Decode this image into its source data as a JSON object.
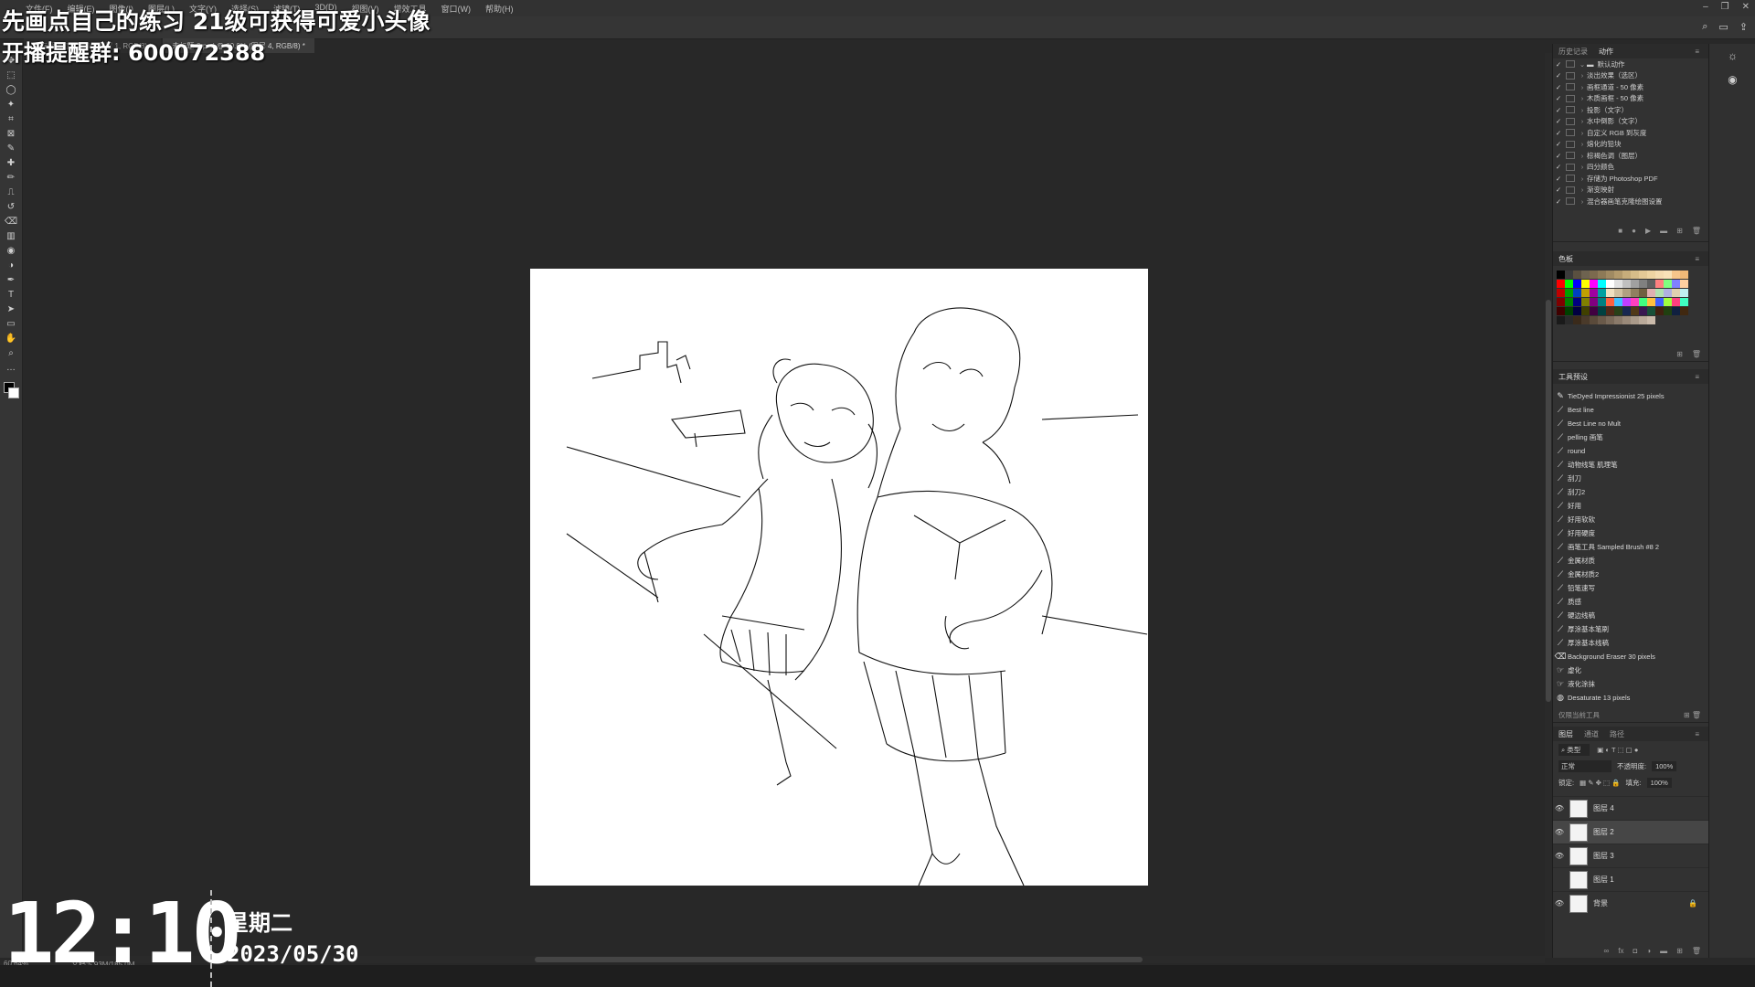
{
  "app": {
    "menu": [
      "文件(F)",
      "编辑(E)",
      "图像(I)",
      "图层(L)",
      "文字(Y)",
      "选择(S)",
      "滤镜(T)",
      "3D(D)",
      "视图(V)",
      "增效工具",
      "窗口(W)",
      "帮助(H)"
    ],
    "window_controls": [
      "–",
      "❐",
      "✕"
    ]
  },
  "doc_tabs": [
    {
      "label": "未标题-1 @ 66.7% (图层 1, RGB/8) *",
      "active": false
    },
    {
      "label": "未标题-2.psd @ 60.6% (图层 4, RGB/8) *",
      "active": true
    }
  ],
  "tools": [
    "move-tool",
    "marquee-tool",
    "lasso-tool",
    "quick-select-tool",
    "crop-tool",
    "frame-tool",
    "eyedropper-tool",
    "healing-tool",
    "brush-tool",
    "stamp-tool",
    "history-brush-tool",
    "eraser-tool",
    "gradient-tool",
    "blur-tool",
    "dodge-tool",
    "pen-tool",
    "type-tool",
    "path-select-tool",
    "shape-tool",
    "hand-tool",
    "zoom-tool",
    "more-tools"
  ],
  "overlay": {
    "line1": "先画点自己的练习 21级可获得可爱小头像",
    "line2": "开播提醒群: 600072388",
    "time": "12:10",
    "weekday": "星期二",
    "date": "2023/05/30"
  },
  "actions_panel": {
    "tabs": [
      "历史记录",
      "动作"
    ],
    "active_tab": "动作",
    "rows": [
      {
        "label": "默认动作",
        "is_folder": true
      },
      {
        "label": "淡出效果（选区）"
      },
      {
        "label": "画框通道 - 50 像素"
      },
      {
        "label": "木质画框 - 50 像素"
      },
      {
        "label": "投影（文字）"
      },
      {
        "label": "水中倒影（文字）"
      },
      {
        "label": "自定义 RGB 到灰度"
      },
      {
        "label": "熔化的铅块"
      },
      {
        "label": "棕褐色调（图层）"
      },
      {
        "label": "四分颜色"
      },
      {
        "label": "存储为 Photoshop PDF"
      },
      {
        "label": "渐变映射"
      },
      {
        "label": "混合器画笔克隆绘图设置"
      }
    ]
  },
  "swatches_panel": {
    "title": "色板",
    "colors_row1": [
      "#000000",
      "#3b3b3b",
      "#5a5040",
      "#6e6350",
      "#7c6a4e",
      "#8d7a57",
      "#a08a62",
      "#b39a6c",
      "#c7ad7b",
      "#d7bd89",
      "#e4c996",
      "#eed4a2",
      "#f4dcb0",
      "#f8e2b8",
      "#f5c58b",
      "#f0b877"
    ],
    "colors_row2": [
      "#ff0000",
      "#00ff00",
      "#0000ff",
      "#ffff00",
      "#ff00ff",
      "#00ffff",
      "#ffffff",
      "#e0e0e0",
      "#c0c0c0",
      "#a0a0a0",
      "#808080",
      "#606060",
      "#ff8080",
      "#80ff80",
      "#8080ff",
      "#ffd0a0"
    ],
    "colors_row3": [
      "#c00000",
      "#00a000",
      "#0040c0",
      "#c0a000",
      "#a000a0",
      "#00a0a0",
      "#f0e0c0",
      "#d0c0a0",
      "#b0a080",
      "#908060",
      "#706040",
      "#e0b0b0",
      "#b0e0b0",
      "#b0b0e0",
      "#e0d0b0",
      "#c0f0f0"
    ],
    "colors_row4": [
      "#800000",
      "#008000",
      "#000080",
      "#808000",
      "#800080",
      "#008080",
      "#ff6040",
      "#40c0ff",
      "#c040ff",
      "#ff40c0",
      "#40ff80",
      "#ffc040",
      "#4060ff",
      "#a0ff40",
      "#ff4080",
      "#40ffc0"
    ],
    "colors_row5": [
      "#400000",
      "#004000",
      "#000040",
      "#404000",
      "#400040",
      "#004040",
      "#502818",
      "#284018",
      "#182850",
      "#503818",
      "#381850",
      "#185038",
      "#402010",
      "#204010",
      "#102040",
      "#402810"
    ],
    "colors_row6": [
      "#1a1a1a",
      "#2a2a2a",
      "#3a2a1a",
      "#4a3a2a",
      "#5a4a3a",
      "#6a5a4a",
      "#7a6a5a",
      "#8a7a6a",
      "#9a8a7a",
      "#aa9a8a",
      "#baaa9a",
      "#cabaaa"
    ]
  },
  "tool_presets_panel": {
    "title": "工具预设",
    "items": [
      {
        "label": "TieDyed Impressionist 25 pixels",
        "icon": "brush-icon"
      },
      {
        "label": "Best line",
        "icon": "pen-icon"
      },
      {
        "label": "Best Line no Mult",
        "icon": "pen-icon"
      },
      {
        "label": "pelling 画笔",
        "icon": "pen-icon"
      },
      {
        "label": "round",
        "icon": "pen-icon"
      },
      {
        "label": "动物线笔 肌理笔",
        "icon": "pen-icon"
      },
      {
        "label": "刮刀",
        "icon": "pen-icon"
      },
      {
        "label": "刮刀2",
        "icon": "pen-icon"
      },
      {
        "label": "好用",
        "icon": "pen-icon"
      },
      {
        "label": "好用软软",
        "icon": "pen-icon"
      },
      {
        "label": "好用硬度",
        "icon": "pen-icon"
      },
      {
        "label": "画笔工具 Sampled Brush #8 2",
        "icon": "pen-icon"
      },
      {
        "label": "金属材质",
        "icon": "pen-icon"
      },
      {
        "label": "金属材质2",
        "icon": "pen-icon"
      },
      {
        "label": "铅笔速写",
        "icon": "pen-icon"
      },
      {
        "label": "质感",
        "icon": "pen-icon"
      },
      {
        "label": "硬边线稿",
        "icon": "pen-icon"
      },
      {
        "label": "厚涂基本笔刷",
        "icon": "pen-icon"
      },
      {
        "label": "厚涂基本线稿",
        "icon": "pen-icon"
      },
      {
        "label": "Background Eraser 30 pixels",
        "icon": "eraser-icon"
      },
      {
        "label": "虚化",
        "icon": "smudge-icon"
      },
      {
        "label": "液化涂抹",
        "icon": "smudge-icon"
      },
      {
        "label": "Desaturate 13 pixels",
        "icon": "sponge-icon"
      }
    ],
    "footer_label": "仅限当前工具"
  },
  "layers_panel": {
    "tabs": [
      "图层",
      "通道",
      "路径"
    ],
    "active_tab": "图层",
    "filter_label": "类型",
    "blend_mode": "正常",
    "opacity_label": "不透明度:",
    "opacity_value": "100%",
    "lock_label": "锁定:",
    "fill_label": "填充:",
    "fill_value": "100%",
    "layers": [
      {
        "name": "图层 4",
        "visible": true,
        "selected": false,
        "locked": false
      },
      {
        "name": "图层 2",
        "visible": true,
        "selected": true,
        "locked": false
      },
      {
        "name": "图层 3",
        "visible": true,
        "selected": false,
        "locked": false
      },
      {
        "name": "图层 1",
        "visible": false,
        "selected": false,
        "locked": false
      },
      {
        "name": "背景",
        "visible": true,
        "selected": false,
        "locked": true
      }
    ],
    "footer_icons": [
      "link-icon",
      "fx-icon",
      "mask-icon",
      "adjustment-icon",
      "group-icon",
      "new-layer-icon",
      "trash-icon"
    ]
  },
  "status": {
    "zoom": "60.64%",
    "doc_info": "文档:5.93M/185.0M"
  }
}
